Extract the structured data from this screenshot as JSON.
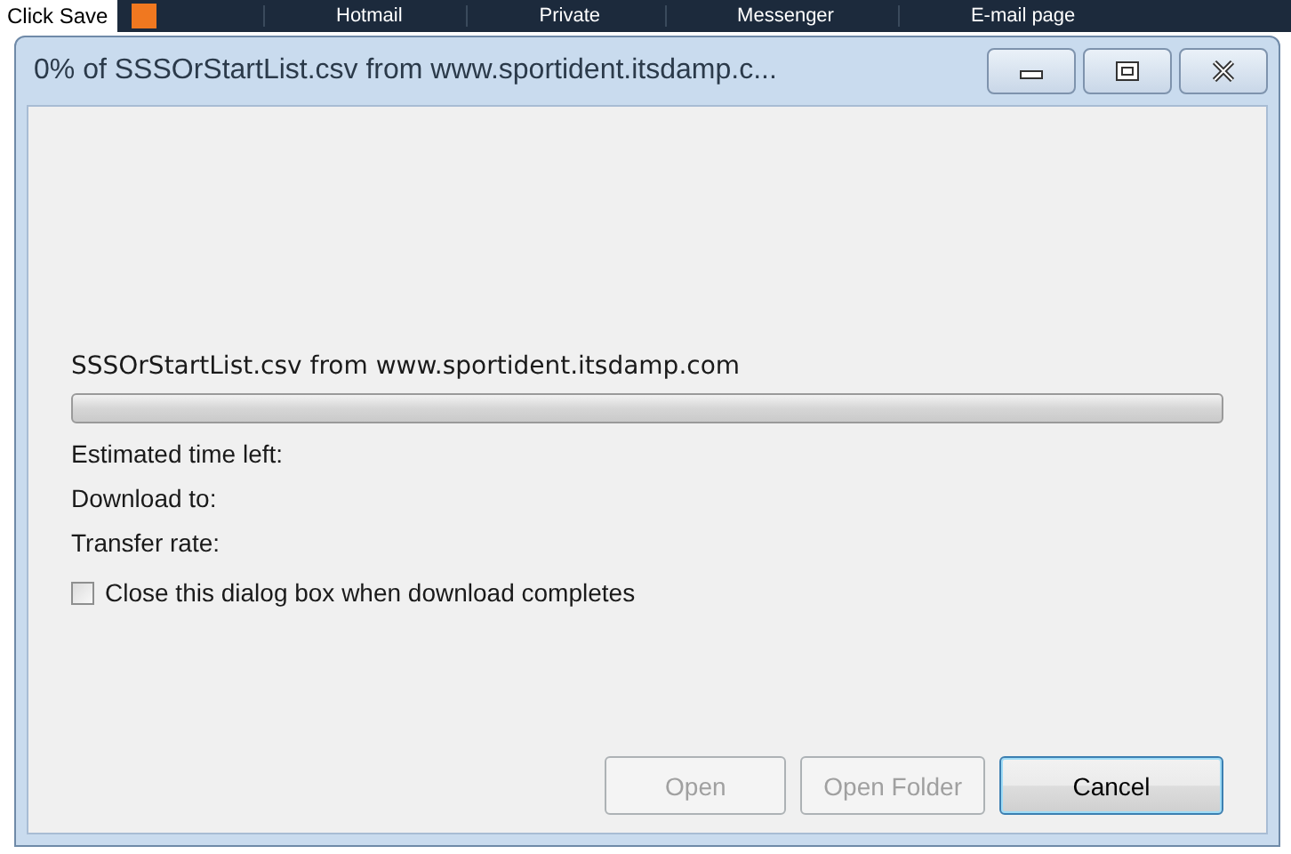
{
  "background": {
    "caption": "Click Save",
    "nav_items": [
      "Hotmail",
      "Private",
      "Messenger",
      "E-mail page"
    ]
  },
  "window": {
    "title": "0% of SSSOrStartList.csv from www.sportident.itsdamp.c..."
  },
  "download": {
    "file": "SSSOrStartList.csv from www.sportident.itsdamp.com",
    "level": 0,
    "fields": [
      "Estimated time left:",
      "Download to:",
      "Transfer rate:"
    ]
  },
  "close_option": {
    "label": "Close this dialog box when download completes",
    "checked": false
  },
  "buttons": [
    {
      "label": "Open",
      "disabled": true,
      "focused": false
    },
    {
      "label": "Open Folder",
      "disabled": true,
      "focused": false
    },
    {
      "label": "Cancel",
      "disabled": false,
      "focused": true
    }
  ]
}
